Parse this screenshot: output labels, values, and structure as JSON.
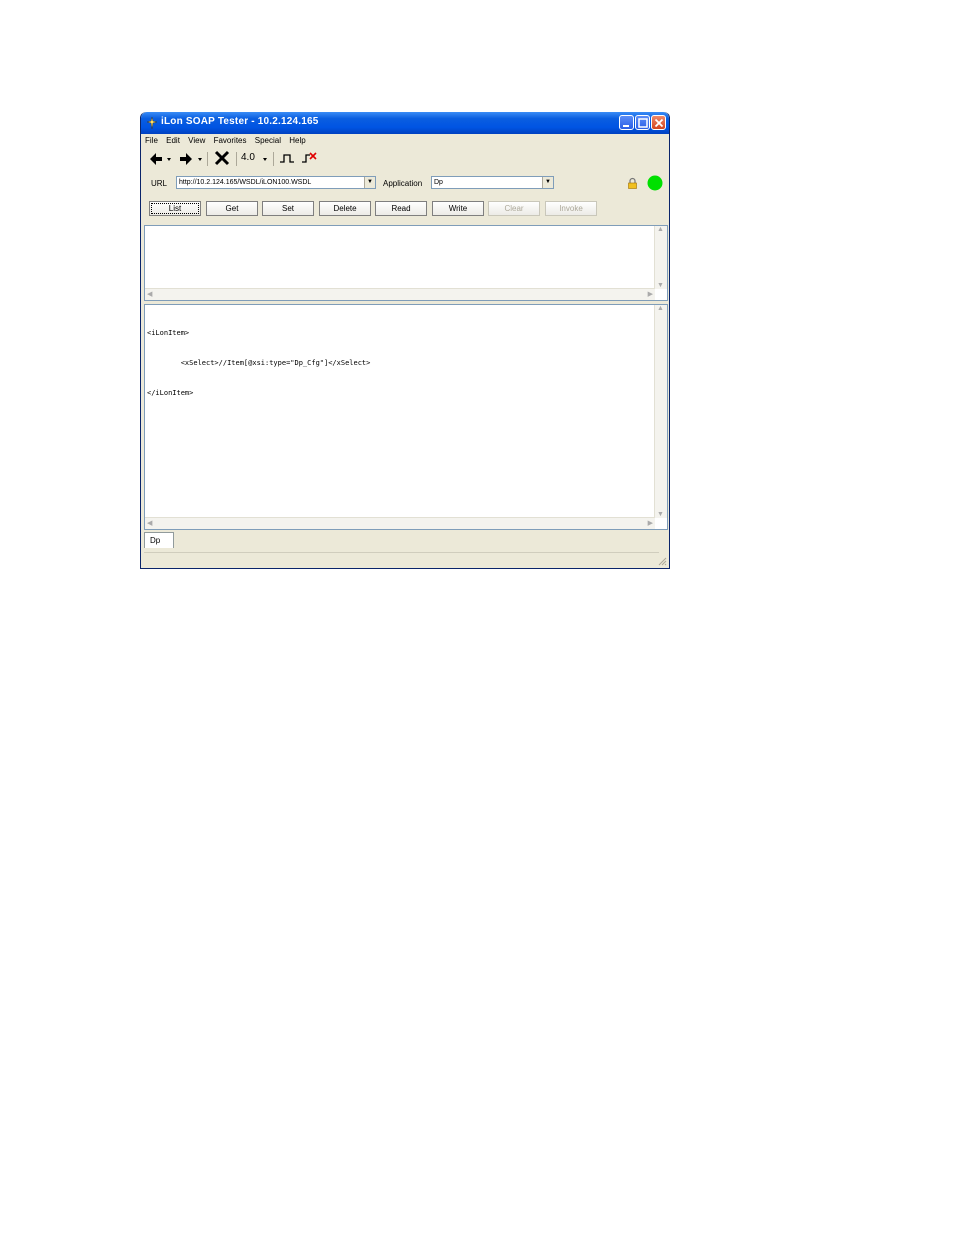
{
  "window": {
    "title": "iLon SOAP Tester - 10.2.124.165"
  },
  "menu": [
    "File",
    "Edit",
    "View",
    "Favorites",
    "Special",
    "Help"
  ],
  "toolbar": {
    "version": "4.0"
  },
  "url_row": {
    "url_label": "URL",
    "url_value": "http://10.2.124.165/WSDL/iLON100.WSDL",
    "application_label": "Application",
    "application_value": "Dp",
    "status_color": "#00e000"
  },
  "buttons": [
    {
      "label": "List",
      "enabled": true,
      "focused": true
    },
    {
      "label": "Get",
      "enabled": true
    },
    {
      "label": "Set",
      "enabled": true
    },
    {
      "label": "Delete",
      "enabled": true
    },
    {
      "label": "Read",
      "enabled": true
    },
    {
      "label": "Write",
      "enabled": true
    },
    {
      "label": "Clear",
      "enabled": false
    },
    {
      "label": "Invoke",
      "enabled": false
    }
  ],
  "request": {
    "line1": "<iLonItem>",
    "line2": "        <xSelect>//Item[@xsi:type=\"Dp_Cfg\"]</xSelect>",
    "line3": "</iLonItem>"
  },
  "tabs": [
    {
      "label": "Dp"
    }
  ],
  "colors": {
    "titlebar": "#0054e3",
    "face": "#ece9d8"
  }
}
